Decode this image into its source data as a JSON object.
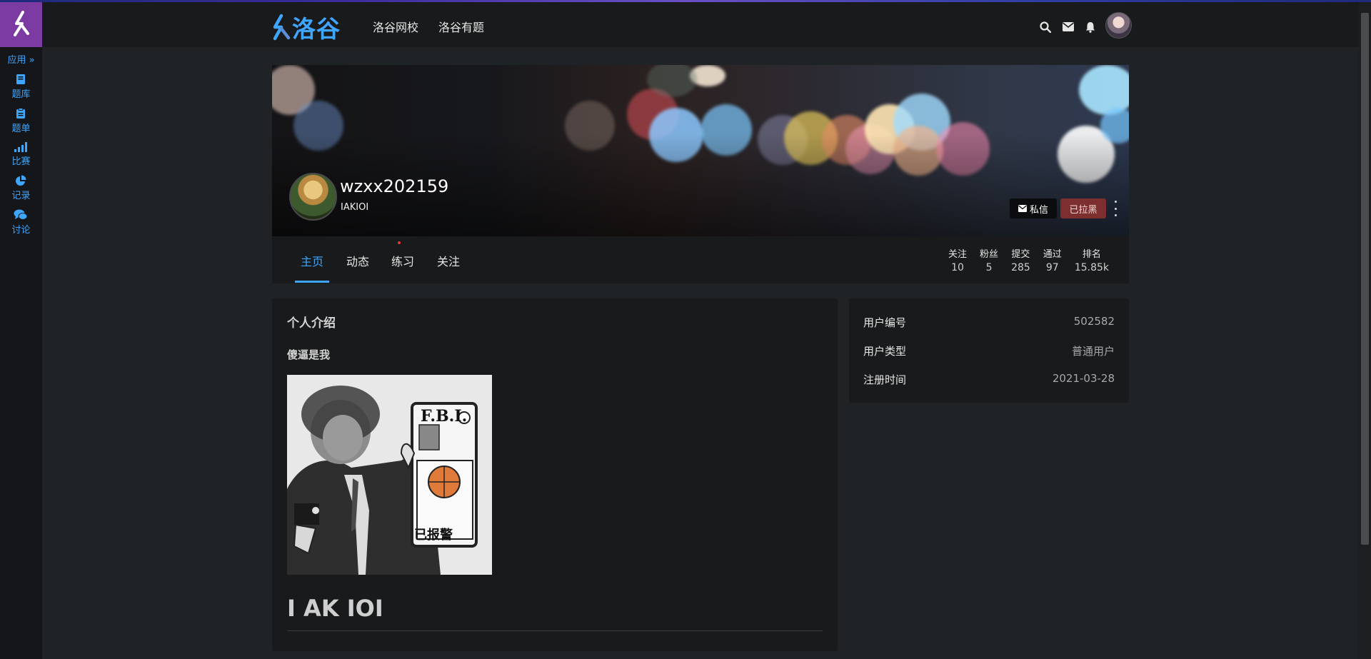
{
  "sidebar": {
    "apps_label": "应用",
    "items": [
      {
        "label": "题库",
        "icon": "book-icon"
      },
      {
        "label": "题单",
        "icon": "clipboard-icon"
      },
      {
        "label": "比赛",
        "icon": "bar-signal-icon"
      },
      {
        "label": "记录",
        "icon": "pie-chart-icon"
      },
      {
        "label": "讨论",
        "icon": "comments-icon"
      }
    ]
  },
  "header": {
    "brand": "洛谷",
    "nav": [
      "洛谷网校",
      "洛谷有题"
    ],
    "icons": [
      "search-icon",
      "envelope-icon",
      "bell-icon",
      "user-avatar"
    ]
  },
  "profile": {
    "username": "wzxx202159",
    "tag": "IAKIOI",
    "dm_button": "私信",
    "block_button": "已拉黑"
  },
  "tabs": [
    "主页",
    "动态",
    "练习",
    "关注"
  ],
  "stats": [
    {
      "label": "关注",
      "value": "10"
    },
    {
      "label": "粉丝",
      "value": "5"
    },
    {
      "label": "提交",
      "value": "285"
    },
    {
      "label": "通过",
      "value": "97"
    },
    {
      "label": "排名",
      "value": "15.85k"
    }
  ],
  "intro": {
    "heading": "个人介绍",
    "text": "傻逼是我",
    "image": {
      "badge_text": "F.B.I.",
      "caption": "已报警"
    },
    "big_text": "I AK IOI"
  },
  "info": [
    {
      "key": "用户编号",
      "value": "502582"
    },
    {
      "key": "用户类型",
      "value": "普通用户"
    },
    {
      "key": "注册时间",
      "value": "2021-03-28"
    }
  ],
  "colors": {
    "accent": "#3ea6ff",
    "logo_bg": "#7b3ba3",
    "block_button": "#7c2f2e",
    "card_bg": "#181a1b",
    "page_bg": "#202325"
  }
}
